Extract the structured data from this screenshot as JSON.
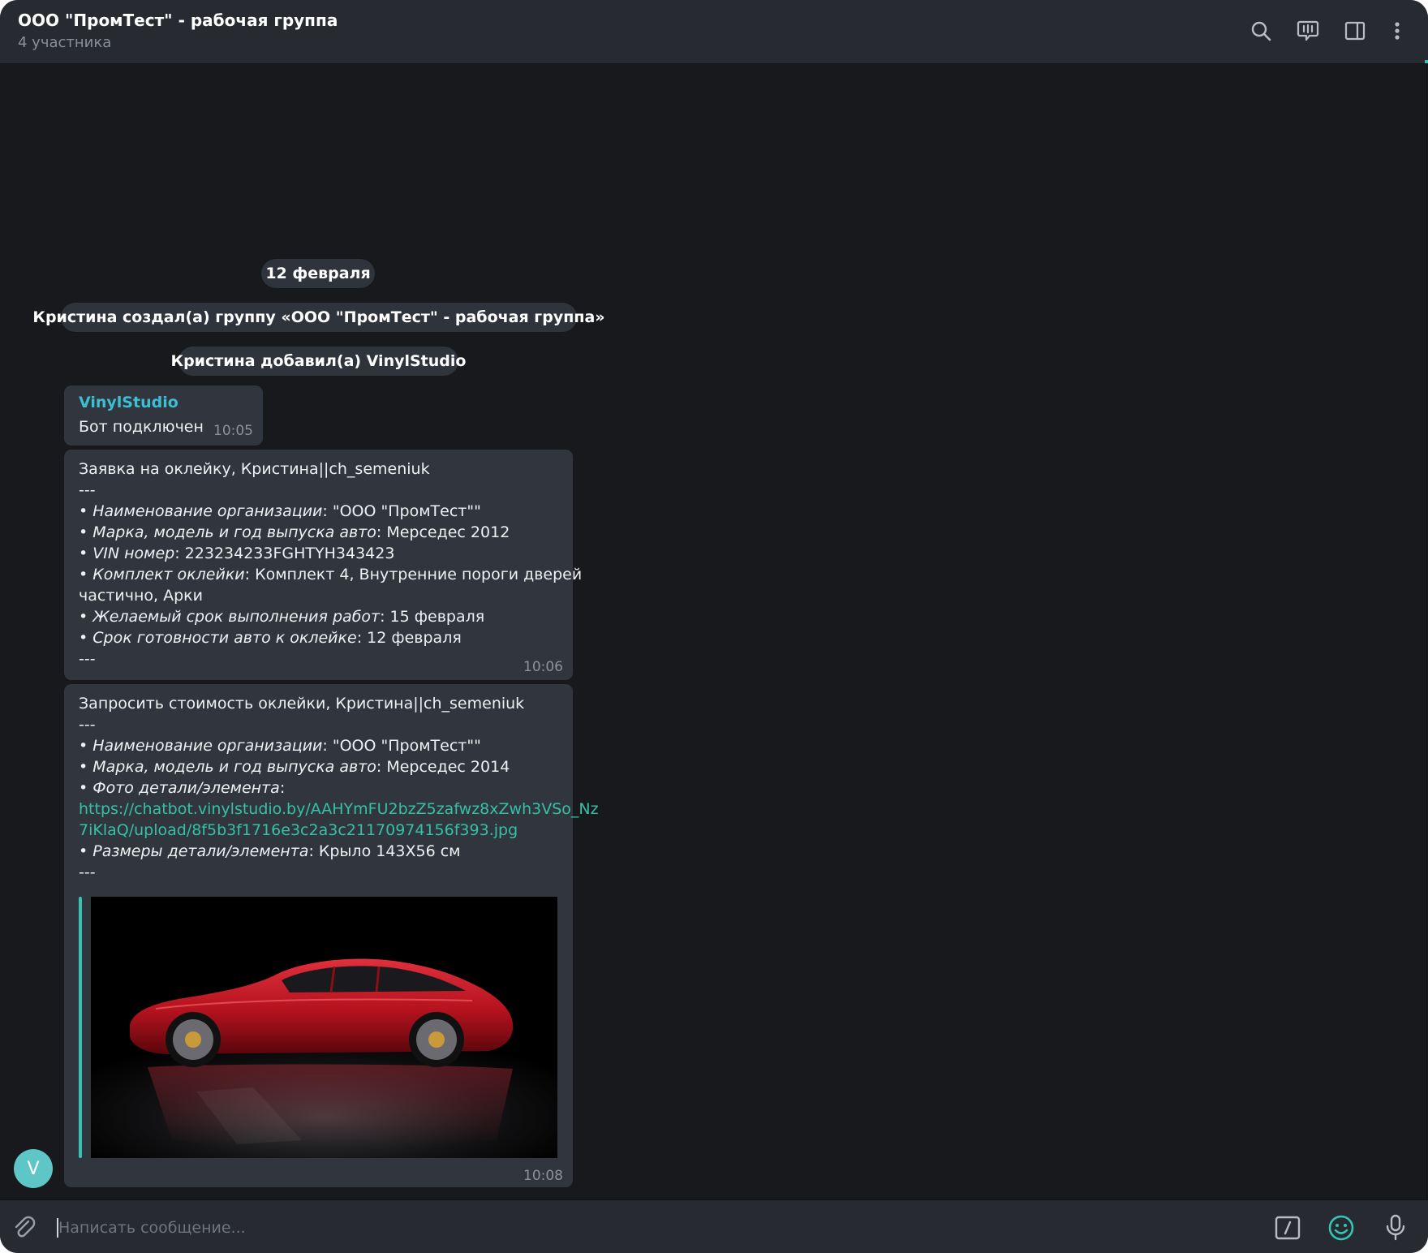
{
  "header": {
    "title": "ООО \"ПромТест\" - рабочая группа",
    "subtitle": "4 участника"
  },
  "service": {
    "date": "12 февраля",
    "created": "Кристина создал(а) группу «ООО \"ПромТест\" - рабочая группа»",
    "added": "Кристина добавил(а) VinylStudio"
  },
  "msg1": {
    "sender": "VinylStudio",
    "text": "Бот подключен",
    "time": "10:05"
  },
  "msg2": {
    "title": "Заявка на оклейку, Кристина||ch_semeniuk",
    "sep": "---",
    "org_label": "• Наименование организации",
    "org_value": ": \"ООО \"ПромТест\"\"",
    "car_label": "• Марка, модель и год выпуска авто",
    "car_value": ": Мерседес 2012",
    "vin_label": "• VIN номер",
    "vin_value": ": 223234233FGHTYH343423",
    "kit_label": "• Комплект оклейки",
    "kit_value": ": Комплект 4, Внутренние пороги дверей",
    "kit_value2": "частично, Арки",
    "deadline_label": "• Желаемый срок выполнения работ",
    "deadline_value": ": 15 февраля",
    "ready_label": "• Срок готовности авто к оклейке",
    "ready_value": ": 12 февраля",
    "sep2": "---",
    "time": "10:06"
  },
  "msg3": {
    "title": "Запросить стоимость оклейки, Кристина||ch_semeniuk",
    "sep": "---",
    "org_label": "• Наименование организации",
    "org_value": ": \"ООО \"ПромТест\"\"",
    "car_label": "• Марка, модель и год выпуска авто",
    "car_value": ": Мерседес 2014",
    "photo_label": "• Фото детали/элемента",
    "photo_colon": ":",
    "link1": "https://chatbot.vinylstudio.by/AAHYmFU2bzZ5zafwz8xZwh3VSo_Nz",
    "link2": "7iKlaQ/upload/8f5b3f1716e3c2a3c21170974156f393.jpg",
    "size_label": "• Размеры детали/элемента",
    "size_value": ": Крыло 143X56 см",
    "sep2": "---",
    "time": "10:08"
  },
  "avatar": {
    "letter": "V"
  },
  "composer": {
    "placeholder": "Написать сообщение..."
  },
  "colors": {
    "accent": "#35c4b4",
    "link": "#35c0a8",
    "sender": "#3bbfd1",
    "bubble": "#31363e",
    "background": "#17191d"
  },
  "icons": [
    "search-icon",
    "voice-chat-icon",
    "sidebar-toggle-icon",
    "more-vertical-icon",
    "attach-icon",
    "bot-commands-icon",
    "emoji-icon",
    "microphone-icon"
  ]
}
